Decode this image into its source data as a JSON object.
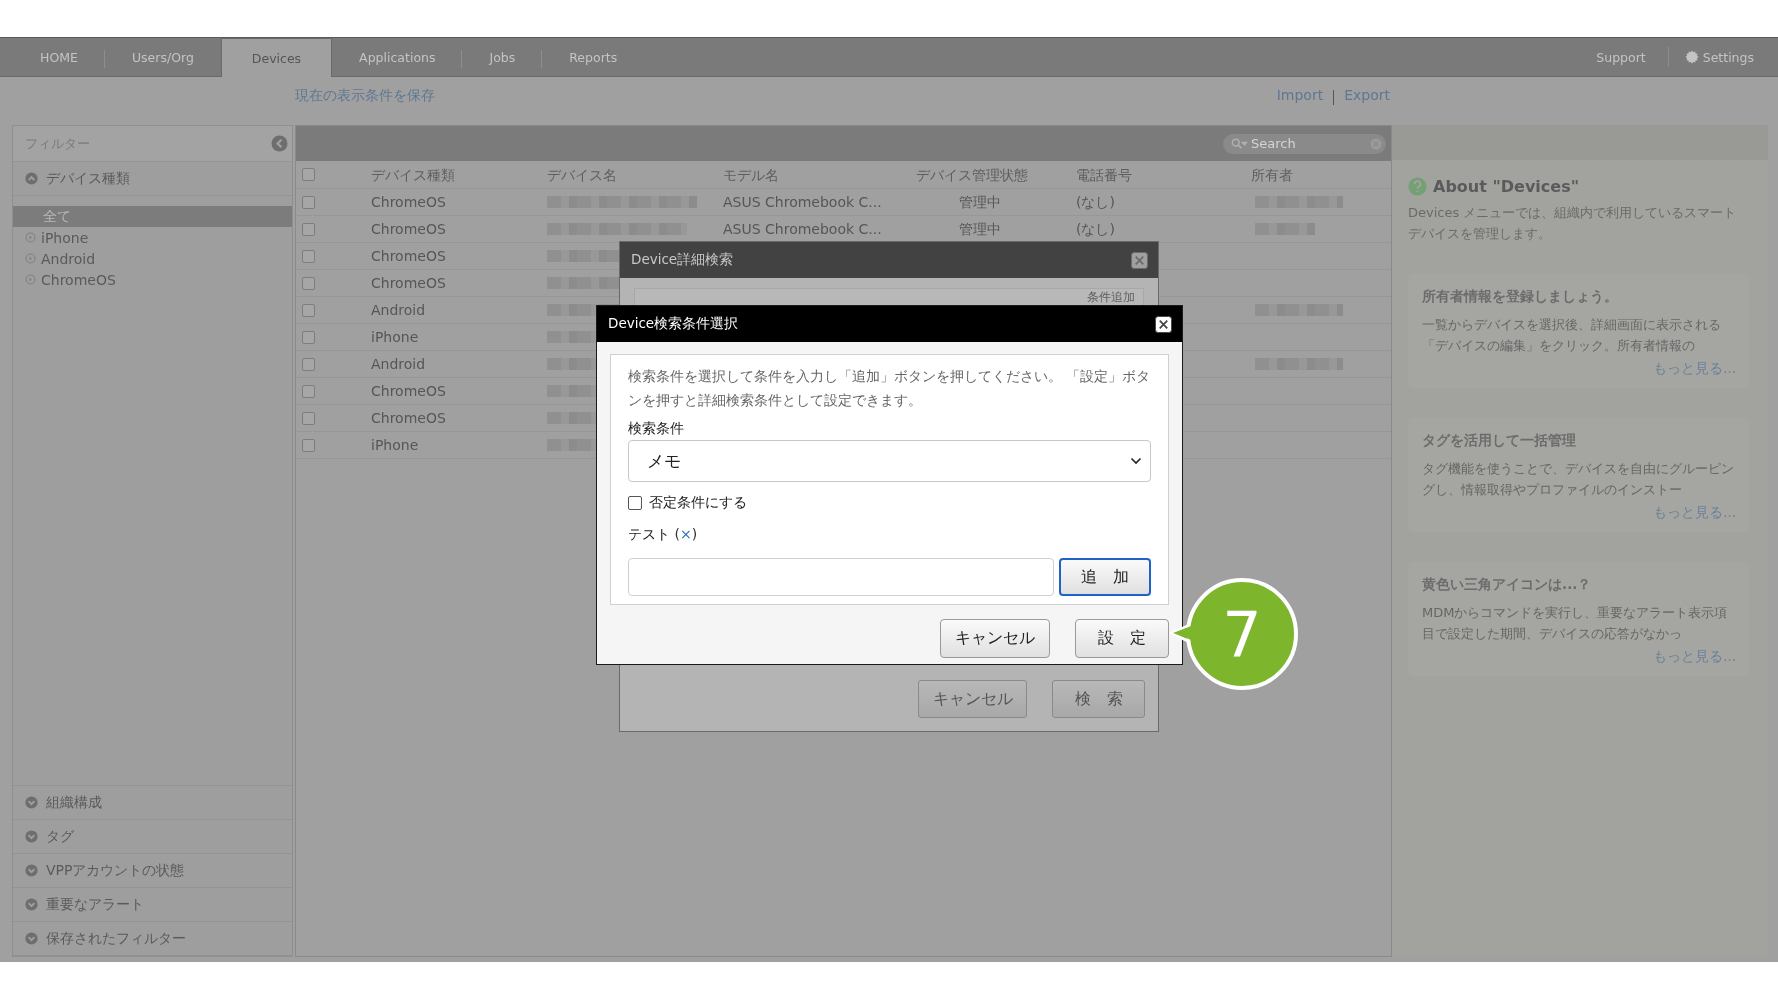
{
  "nav": {
    "tabs": [
      {
        "label": "HOME",
        "selected": false
      },
      {
        "label": "Users/Org",
        "selected": false
      },
      {
        "label": "Devices",
        "selected": true
      },
      {
        "label": "Applications",
        "selected": false
      },
      {
        "label": "Jobs",
        "selected": false
      },
      {
        "label": "Reports",
        "selected": false
      }
    ],
    "support": "Support",
    "settings": "Settings"
  },
  "toolbar": {
    "save_link": "現在の表示条件を保存",
    "import": "Import",
    "export": "Export"
  },
  "sidebar": {
    "title": "フィルター",
    "sections": [
      {
        "label": "デバイス種類",
        "expanded": true,
        "items": [
          {
            "label": "全て",
            "selected": true
          },
          {
            "label": "iPhone",
            "selected": false
          },
          {
            "label": "Android",
            "selected": false
          },
          {
            "label": "ChromeOS",
            "selected": false
          }
        ]
      },
      {
        "label": "組織構成",
        "expanded": false
      },
      {
        "label": "タグ",
        "expanded": false
      },
      {
        "label": "VPPアカウントの状態",
        "expanded": false
      },
      {
        "label": "重要なアラート",
        "expanded": false
      },
      {
        "label": "保存されたフィルター",
        "expanded": false
      }
    ]
  },
  "table": {
    "search": {
      "placeholder": "Search"
    },
    "select_all_checked": false,
    "columns": [
      "デバイス種類",
      "デバイス名",
      "モデル名",
      "デバイス管理状態",
      "電話番号",
      "所有者"
    ],
    "rows": [
      {
        "checked": false,
        "type": "ChromeOS",
        "model": "ASUS Chromebook C...",
        "status": "管理中",
        "phone": "(なし)",
        "owner_redacted": true
      },
      {
        "checked": false,
        "type": "ChromeOS",
        "model": "ASUS Chromebook C...",
        "status": "管理中",
        "phone": "(なし)",
        "owner_redacted": true
      },
      {
        "checked": false,
        "type": "ChromeOS",
        "owner_redacted": false
      },
      {
        "checked": false,
        "type": "ChromeOS",
        "owner_redacted": false
      },
      {
        "checked": false,
        "type": "Android",
        "owner_redacted": true
      },
      {
        "checked": false,
        "type": "iPhone",
        "owner_redacted": false
      },
      {
        "checked": false,
        "type": "Android",
        "owner_redacted": true
      },
      {
        "checked": false,
        "type": "ChromeOS",
        "owner_redacted": false
      },
      {
        "checked": false,
        "type": "ChromeOS",
        "owner_redacted": false
      },
      {
        "checked": false,
        "type": "iPhone",
        "owner_redacted": false
      }
    ]
  },
  "about": {
    "title": "About \"Devices\"",
    "text": "Devices メニューでは、組織内で利用しているスマートデバイスを管理します。",
    "cards": [
      {
        "title": "所有者情報を登録しましょう。",
        "text": "一覧からデバイスを選択後、詳細画面に表示される「デバイスの編集」をクリック。所有者情報の",
        "more": "もっと見る..."
      },
      {
        "title": "タグを活用して一括管理",
        "text": "タグ機能を使うことで、デバイスを自由にグルーピングし、情報取得やプロファイルのインストー",
        "more": "もっと見る..."
      },
      {
        "title": "黄色い三角アイコンは...？",
        "text": "MDMからコマンドを実行し、重要なアラート表示項目で設定した期間、デバイスの応答がなかっ",
        "more": "もっと見る..."
      }
    ]
  },
  "search_dialog": {
    "title": "Device詳細検索",
    "add_condition": "条件追加",
    "buttons": [
      "キャンセル",
      "検　索"
    ]
  },
  "condition_dialog": {
    "title": "Device検索条件選択",
    "instructions": "検索条件を選択して条件を入力し「追加」ボタンを押してください。 「設定」ボタンを押すと詳細検索条件として設定できます。",
    "condition_label": "検索条件",
    "condition_value": "メモ",
    "negate": {
      "label": "否定条件にする",
      "checked": false
    },
    "test_label": "テスト",
    "test_remove": "(×)",
    "add_button": {
      "label": "追　加",
      "focused": true
    },
    "buttons": [
      "キャンセル",
      "設　定"
    ]
  },
  "callout": {
    "number": "7"
  }
}
